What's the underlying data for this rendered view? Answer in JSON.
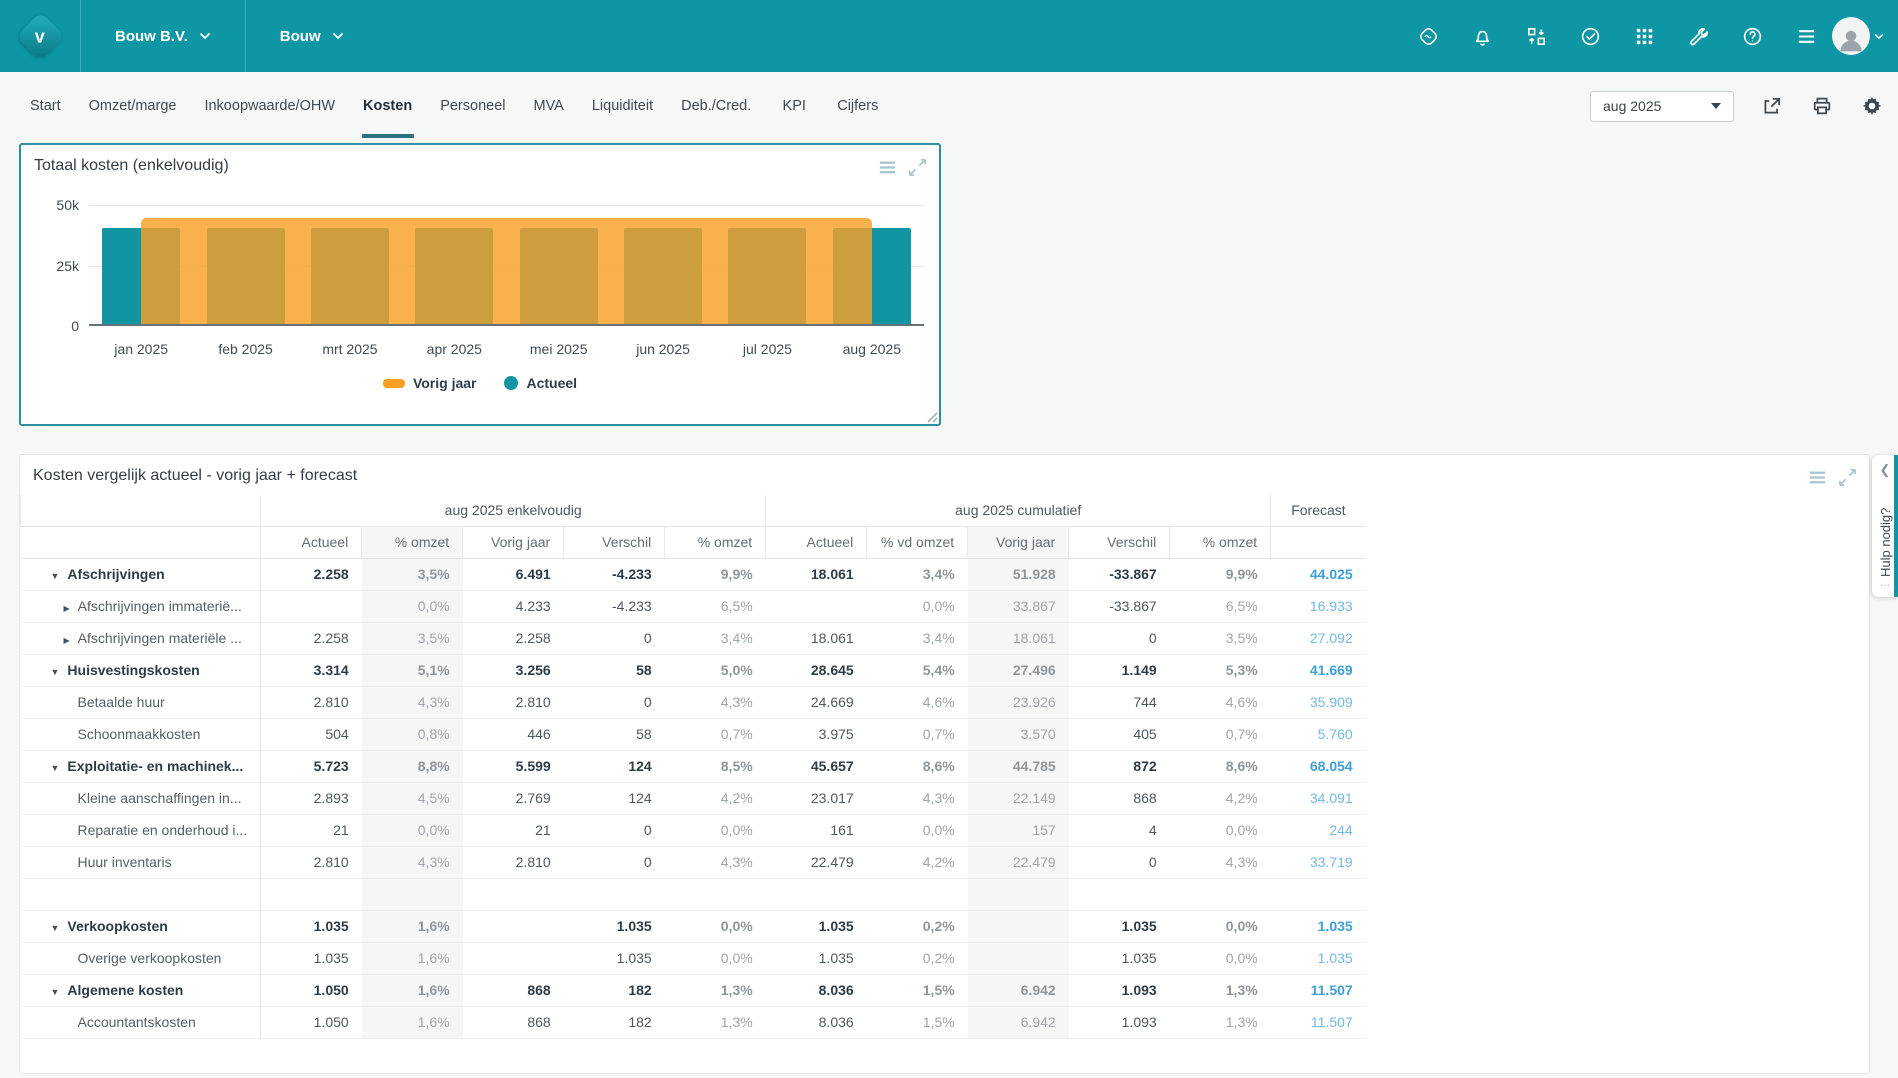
{
  "colors": {
    "header_teal": "#0e96a4",
    "actual_teal": "#1295a3",
    "previous_year_orange": "#f7a026",
    "active_tab_underline": "#2f7080",
    "forecast_blue": "#56a9dc",
    "shaded_column_bg": "#f5f6f6"
  },
  "header": {
    "company": "Bouw B.V.",
    "dashboard": "Bouw",
    "icon_names": [
      "brand-mark-icon",
      "notifications-bell-icon",
      "import-export-icon",
      "tasks-check-icon",
      "apps-grid-icon",
      "tools-wrench-icon",
      "help-icon",
      "menu-icon"
    ]
  },
  "nav": {
    "tabs": [
      "Start",
      "Omzet/marge",
      "Inkoopwaarde/OHW",
      "Kosten",
      "Personeel",
      "MVA",
      "Liquiditeit",
      "Deb./Cred.",
      "KPI",
      "Cijfers"
    ],
    "active_tab": "Kosten"
  },
  "toolbar": {
    "period_value": "aug 2025",
    "icon_names": [
      "share-icon",
      "print-icon",
      "settings-gear-icon"
    ]
  },
  "chart_panel": {
    "title": "Totaal kosten (enkelvoudig)"
  },
  "chart_data": {
    "type": "bar",
    "title": "Totaal kosten (enkelvoudig)",
    "categories": [
      "jan 2025",
      "feb 2025",
      "mrt 2025",
      "apr 2025",
      "mei 2025",
      "jun 2025",
      "jul 2025",
      "aug 2025"
    ],
    "series": [
      {
        "name": "Vorig jaar",
        "color": "#f7a026",
        "values": [
          44000,
          44000,
          44000,
          44000,
          44000,
          44000,
          44000,
          44000
        ]
      },
      {
        "name": "Actueel",
        "color": "#1295a3",
        "values": [
          39500,
          39500,
          39500,
          39500,
          39500,
          39500,
          39500,
          39500
        ]
      }
    ],
    "ylim": [
      0,
      50000
    ],
    "yticks": [
      {
        "value": 50000,
        "label": "50k"
      },
      {
        "value": 25000,
        "label": "25k"
      },
      {
        "value": 0,
        "label": "0"
      }
    ],
    "grid": true,
    "legend_position": "bottom"
  },
  "table_panel": {
    "title": "Kosten vergelijk actueel - vorig jaar + forecast",
    "group_headers": [
      {
        "label": "",
        "span": 1
      },
      {
        "label": "aug 2025 enkelvoudig",
        "span": 5
      },
      {
        "label": "aug 2025 cumulatief",
        "span": 5
      },
      {
        "label": "Forecast",
        "span": 1
      }
    ],
    "columns": [
      "Actueel",
      "% omzet",
      "Vorig jaar",
      "Verschil",
      "% omzet",
      "Actueel",
      "% vd omzet",
      "Vorig jaar",
      "Verschil",
      "% omzet"
    ],
    "rows": [
      {
        "label": "Afschrijvingen",
        "level": "parent",
        "expand": "down",
        "cells": [
          "2.258",
          "3,5%",
          "6.491",
          "-4.233",
          "9,9%",
          "18.061",
          "3,4%",
          "51.928",
          "-33.867",
          "9,9%",
          "44.025"
        ]
      },
      {
        "label": "Afschrijvingen immaterië...",
        "level": "child",
        "expand": "right",
        "cells": [
          "",
          "0,0%",
          "4.233",
          "-4.233",
          "6,5%",
          "",
          "0,0%",
          "33.867",
          "-33.867",
          "6,5%",
          "16.933"
        ]
      },
      {
        "label": "Afschrijvingen materiële ...",
        "level": "child",
        "expand": "right",
        "cells": [
          "2.258",
          "3,5%",
          "2.258",
          "0",
          "3,4%",
          "18.061",
          "3,4%",
          "18.061",
          "0",
          "3,5%",
          "27.092"
        ]
      },
      {
        "label": "Huisvestingskosten",
        "level": "parent",
        "expand": "down",
        "cells": [
          "3.314",
          "5,1%",
          "3.256",
          "58",
          "5,0%",
          "28.645",
          "5,4%",
          "27.496",
          "1.149",
          "5,3%",
          "41.669"
        ]
      },
      {
        "label": "Betaalde huur",
        "level": "child",
        "expand": "none",
        "cells": [
          "2.810",
          "4,3%",
          "2.810",
          "0",
          "4,3%",
          "24.669",
          "4,6%",
          "23.926",
          "744",
          "4,6%",
          "35.909"
        ]
      },
      {
        "label": "Schoonmaakkosten",
        "level": "child",
        "expand": "none",
        "cells": [
          "504",
          "0,8%",
          "446",
          "58",
          "0,7%",
          "3.975",
          "0,7%",
          "3.570",
          "405",
          "0,7%",
          "5.760"
        ]
      },
      {
        "label": "Exploitatie- en machinek...",
        "level": "parent",
        "expand": "down",
        "cells": [
          "5.723",
          "8,8%",
          "5.599",
          "124",
          "8,5%",
          "45.657",
          "8,6%",
          "44.785",
          "872",
          "8,6%",
          "68.054"
        ]
      },
      {
        "label": "Kleine aanschaffingen in...",
        "level": "child",
        "expand": "none",
        "cells": [
          "2.893",
          "4,5%",
          "2.769",
          "124",
          "4,2%",
          "23.017",
          "4,3%",
          "22.149",
          "868",
          "4,2%",
          "34.091"
        ]
      },
      {
        "label": "Reparatie en onderhoud i...",
        "level": "child",
        "expand": "none",
        "cells": [
          "21",
          "0,0%",
          "21",
          "0",
          "0,0%",
          "161",
          "0,0%",
          "157",
          "4",
          "0,0%",
          "244"
        ]
      },
      {
        "label": "Huur inventaris",
        "level": "child",
        "expand": "none",
        "cells": [
          "2.810",
          "4,3%",
          "2.810",
          "0",
          "4,3%",
          "22.479",
          "4,2%",
          "22.479",
          "0",
          "4,3%",
          "33.719"
        ]
      },
      {
        "label": "",
        "level": "spacer",
        "expand": "none",
        "cells": [
          "",
          "",
          "",
          "",
          "",
          "",
          "",
          "",
          "",
          "",
          ""
        ]
      },
      {
        "label": "Verkoopkosten",
        "level": "parent",
        "expand": "down",
        "cells": [
          "1.035",
          "1,6%",
          "",
          "1.035",
          "0,0%",
          "1.035",
          "0,2%",
          "",
          "1.035",
          "0,0%",
          "1.035"
        ]
      },
      {
        "label": "Overige verkoopkosten",
        "level": "child",
        "expand": "none",
        "cells": [
          "1.035",
          "1,6%",
          "",
          "1.035",
          "0,0%",
          "1.035",
          "0,2%",
          "",
          "1.035",
          "0,0%",
          "1.035"
        ]
      },
      {
        "label": "Algemene kosten",
        "level": "parent",
        "expand": "down",
        "cells": [
          "1.050",
          "1,6%",
          "868",
          "182",
          "1,3%",
          "8.036",
          "1,5%",
          "6.942",
          "1.093",
          "1,3%",
          "11.507"
        ]
      },
      {
        "label": "Accountantskosten",
        "level": "child",
        "expand": "none",
        "cells": [
          "1.050",
          "1,6%",
          "868",
          "182",
          "1,3%",
          "8.036",
          "1,5%",
          "6.942",
          "1.093",
          "1,3%",
          "11.507"
        ]
      }
    ]
  },
  "help_tab": {
    "label": "Hulp nodig?",
    "dots": "…"
  }
}
